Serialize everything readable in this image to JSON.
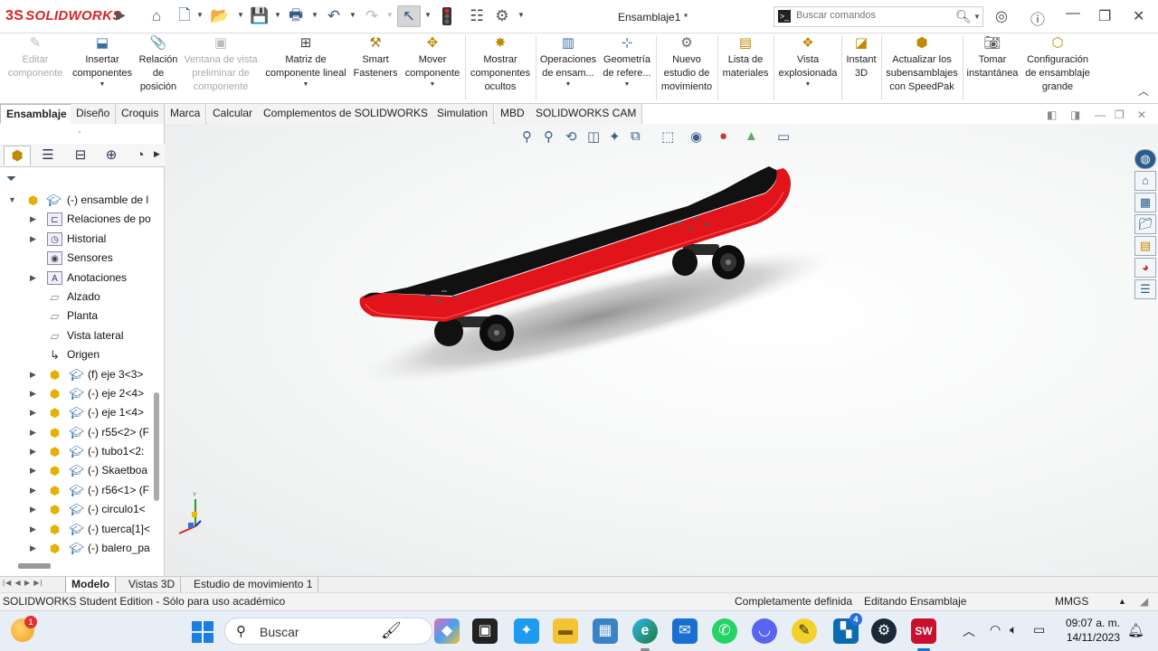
{
  "titlebar": {
    "logo_mark": "3S",
    "logo_text": "SOLIDWORKS",
    "document_title": "Ensamblaje1 *",
    "search_placeholder": "Buscar comandos",
    "icons": [
      "home-icon",
      "new-document-icon",
      "open-folder-icon",
      "save-icon",
      "print-icon",
      "undo-icon",
      "redo-icon",
      "select-pointer-icon",
      "traffic-light-icon",
      "file-properties-icon",
      "options-gear-icon",
      "user-icon",
      "help-icon",
      "minimize-icon",
      "restore-icon",
      "close-icon"
    ]
  },
  "ribbon": {
    "buttons": [
      {
        "label": "Editar componente",
        "icon": "edit-component-icon",
        "enabled": false
      },
      {
        "label": "Insertar componentes",
        "icon": "insert-components-icon",
        "enabled": true
      },
      {
        "label": "Relación de posición",
        "icon": "mate-paperclip-icon",
        "enabled": true
      },
      {
        "label": "Ventana de vista preliminar de componente",
        "icon": "preview-window-icon",
        "enabled": false
      },
      {
        "label": "Matriz de componente lineal",
        "icon": "linear-pattern-icon",
        "enabled": true
      },
      {
        "label": "Smart Fasteners",
        "icon": "smart-fasteners-icon",
        "enabled": true
      },
      {
        "label": "Mover componente",
        "icon": "move-component-icon",
        "enabled": true
      },
      {
        "label": "Mostrar componentes ocultos",
        "icon": "show-hidden-icon",
        "enabled": true
      },
      {
        "label": "Operaciones de ensam...",
        "icon": "assembly-features-icon",
        "enabled": true
      },
      {
        "label": "Geometría de refere...",
        "icon": "reference-geometry-icon",
        "enabled": true
      },
      {
        "label": "Nuevo estudio de movimiento",
        "icon": "motion-study-icon",
        "enabled": true
      },
      {
        "label": "Lista de materiales",
        "icon": "bill-of-materials-icon",
        "enabled": true
      },
      {
        "label": "Vista explosionada",
        "icon": "exploded-view-icon",
        "enabled": true
      },
      {
        "label": "Instant 3D",
        "icon": "instant-3d-icon",
        "enabled": true
      },
      {
        "label": "Actualizar los subensamblajes con SpeedPak",
        "icon": "speedpak-icon",
        "enabled": true
      },
      {
        "label": "Tomar instantánea",
        "icon": "camera-icon",
        "enabled": true
      },
      {
        "label": "Configuración de ensamblaje grande",
        "icon": "large-assembly-icon",
        "enabled": true
      }
    ]
  },
  "tabs": [
    {
      "label": "Ensamblaje",
      "active": true
    },
    {
      "label": "Diseño",
      "active": false
    },
    {
      "label": "Croquis",
      "active": false
    },
    {
      "label": "Marca",
      "active": false
    },
    {
      "label": "Calcular",
      "active": false
    },
    {
      "label": "Complementos de SOLIDWORKS",
      "active": false
    },
    {
      "label": "Simulation",
      "active": false
    },
    {
      "label": "MBD",
      "active": false
    },
    {
      "label": "SOLIDWORKS CAM",
      "active": false
    }
  ],
  "feature_tree": {
    "root": "(-) ensamble de l",
    "items": [
      {
        "label": "Relaciones de po",
        "icon": "mates-folder-icon",
        "expandable": true
      },
      {
        "label": "Historial",
        "icon": "history-icon",
        "expandable": true
      },
      {
        "label": "Sensores",
        "icon": "sensors-icon",
        "expandable": false
      },
      {
        "label": "Anotaciones",
        "icon": "annotations-icon",
        "expandable": true
      },
      {
        "label": "Alzado",
        "icon": "plane-icon",
        "expandable": false
      },
      {
        "label": "Planta",
        "icon": "plane-icon",
        "expandable": false
      },
      {
        "label": "Vista lateral",
        "icon": "plane-icon",
        "expandable": false
      },
      {
        "label": "Origen",
        "icon": "origin-icon",
        "expandable": false
      },
      {
        "label": "(f) eje 3<3>",
        "icon": "part-icon",
        "expandable": true
      },
      {
        "label": "(-) eje 2<4>",
        "icon": "part-icon",
        "expandable": true
      },
      {
        "label": "(-) eje 1<4>",
        "icon": "part-icon",
        "expandable": true
      },
      {
        "label": "(-) r55<2> (F",
        "icon": "part-icon",
        "expandable": true
      },
      {
        "label": "(-) tubo1<2:",
        "icon": "part-icon",
        "expandable": true
      },
      {
        "label": "(-) Skaetboa",
        "icon": "part-icon",
        "expandable": true
      },
      {
        "label": "(-) r56<1> (F",
        "icon": "part-icon",
        "expandable": true
      },
      {
        "label": "(-) circulo1<",
        "icon": "part-icon",
        "expandable": true
      },
      {
        "label": "(-) tuerca[1]<",
        "icon": "part-icon",
        "expandable": true
      },
      {
        "label": "(-) balero_pa",
        "icon": "part-icon",
        "expandable": true
      }
    ]
  },
  "bottom_tabs": [
    {
      "label": "Modelo",
      "active": true
    },
    {
      "label": "Vistas 3D",
      "active": false
    },
    {
      "label": "Estudio de movimiento 1",
      "active": false
    }
  ],
  "status": {
    "edition": "SOLIDWORKS Student Edition - Sólo para uso académico",
    "definition": "Completamente definida",
    "mode": "Editando Ensamblaje",
    "units": "MMGS"
  },
  "triad": {
    "y_label": "Y"
  },
  "taskbar": {
    "weather_badge": "1",
    "search_label": "Buscar",
    "store_badge": "4",
    "clock_time": "09:07 a. m.",
    "clock_date": "14/11/2023",
    "apps": [
      "copilot-icon",
      "task-view-icon",
      "twitter-icon",
      "file-explorer-icon",
      "photos-icon",
      "edge-icon",
      "mail-icon",
      "whatsapp-icon",
      "discord-icon",
      "pen-app-icon",
      "store-icon",
      "steam-icon",
      "solidworks-icon"
    ]
  },
  "colors": {
    "deck_top": "#111111",
    "deck_rail": "#e0141a",
    "accent_blue": "#2b6da8",
    "logo_red": "#d22222"
  }
}
